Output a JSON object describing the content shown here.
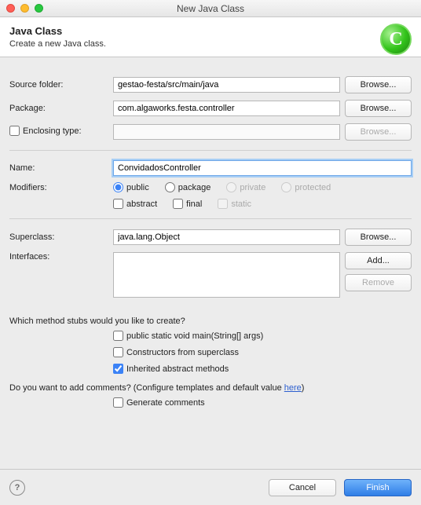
{
  "window": {
    "title": "New Java Class"
  },
  "header": {
    "heading": "Java Class",
    "sub": "Create a new Java class.",
    "icon_letter": "C"
  },
  "labels": {
    "source_folder": "Source folder:",
    "package": "Package:",
    "enclosing": "Enclosing type:",
    "name": "Name:",
    "modifiers": "Modifiers:",
    "superclass": "Superclass:",
    "interfaces": "Interfaces:"
  },
  "fields": {
    "source_folder": "gestao-festa/src/main/java",
    "package": "com.algaworks.festa.controller",
    "enclosing": "",
    "name": "ConvidadosController",
    "superclass": "java.lang.Object"
  },
  "buttons": {
    "browse": "Browse...",
    "add": "Add...",
    "remove": "Remove",
    "cancel": "Cancel",
    "finish": "Finish"
  },
  "modifiers": {
    "public": "public",
    "package": "package",
    "private": "private",
    "protected": "protected",
    "abstract": "abstract",
    "final": "final",
    "static": "static"
  },
  "stubs": {
    "question": "Which method stubs would you like to create?",
    "main": "public static void main(String[] args)",
    "constructors": "Constructors from superclass",
    "inherited": "Inherited abstract methods"
  },
  "comments": {
    "prefix": "Do you want to add comments? (Configure templates and default value ",
    "link": "here",
    "suffix": ")",
    "generate": "Generate comments"
  },
  "help_glyph": "?"
}
